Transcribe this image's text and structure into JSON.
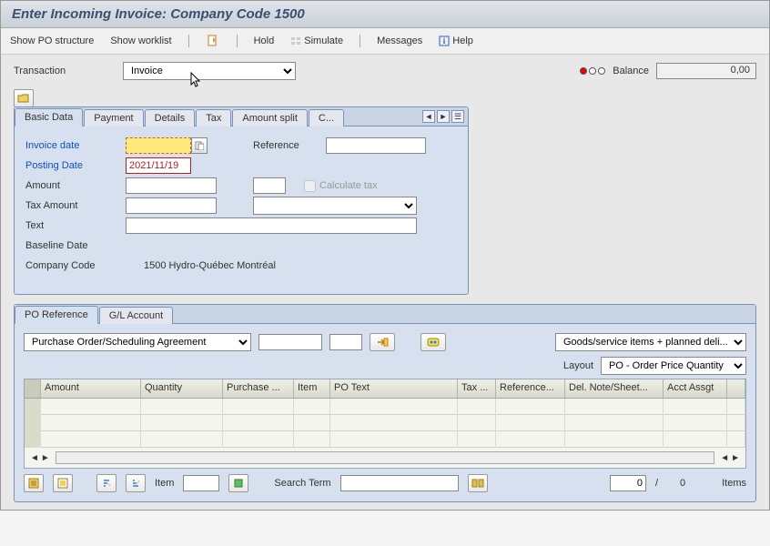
{
  "title": "Enter Incoming Invoice: Company Code 1500",
  "toolbar": {
    "show_po": "Show PO structure",
    "show_worklist": "Show worklist",
    "hold": "Hold",
    "simulate": "Simulate",
    "messages": "Messages",
    "help": "Help"
  },
  "transaction": {
    "label": "Transaction",
    "value": "Invoice"
  },
  "balance": {
    "label": "Balance",
    "value": "0,00"
  },
  "tabs": {
    "basic": "Basic Data",
    "payment": "Payment",
    "details": "Details",
    "tax": "Tax",
    "amount_split": "Amount split",
    "contacts": "C..."
  },
  "form": {
    "invoice_date_lbl": "Invoice date",
    "invoice_date_val": "",
    "reference_lbl": "Reference",
    "reference_val": "",
    "posting_date_lbl": "Posting Date",
    "posting_date_val": "2021/11/19",
    "amount_lbl": "Amount",
    "amount_val": "",
    "currency_val": "",
    "calc_tax_lbl": "Calculate tax",
    "tax_amount_lbl": "Tax Amount",
    "tax_amount_val": "",
    "tax_code_val": "",
    "text_lbl": "Text",
    "text_val": "",
    "baseline_lbl": "Baseline Date",
    "company_lbl": "Company Code",
    "company_val": "1500 Hydro-Québec Montréal"
  },
  "lower_tabs": {
    "po_ref": "PO Reference",
    "gl": "G/L Account"
  },
  "selectbar": {
    "po_type": "Purchase Order/Scheduling Agreement",
    "po_num": "",
    "item": "",
    "goods": "Goods/service items + planned deli..."
  },
  "layout": {
    "label": "Layout",
    "value": "PO - Order Price Quantity"
  },
  "grid_cols": {
    "amount": "Amount",
    "quantity": "Quantity",
    "po": "Purchase ...",
    "item": "Item",
    "potext": "PO Text",
    "tax": "Tax ...",
    "ref": "Reference...",
    "del": "Del. Note/Sheet...",
    "acct": "Acct Assgt"
  },
  "footer": {
    "item_lbl": "Item",
    "item_val": "",
    "search_lbl": "Search Term",
    "search_val": "",
    "pos": "0",
    "sep": "/",
    "total": "0",
    "items_lbl": "Items"
  }
}
